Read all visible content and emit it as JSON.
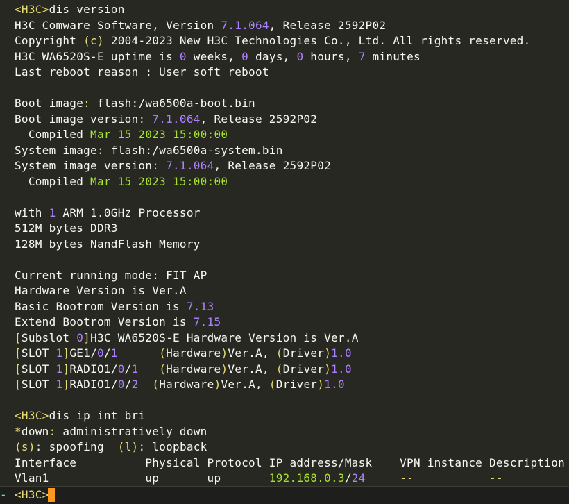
{
  "terminal": {
    "lines": [
      [
        [
          "y",
          "<H3C>"
        ],
        [
          "p",
          "dis version"
        ]
      ],
      [
        [
          "p",
          "H3C Comware Software, Version "
        ],
        [
          "n",
          "7.1.064"
        ],
        [
          "p",
          ", Release 2592P02"
        ]
      ],
      [
        [
          "p",
          "Copyright "
        ],
        [
          "y",
          "(c)"
        ],
        [
          "p",
          " 2004-2023 New H3C Technologies Co., Ltd. All rights reserved."
        ]
      ],
      [
        [
          "p",
          "H3C WA6520S-E uptime is "
        ],
        [
          "n",
          "0"
        ],
        [
          "p",
          " weeks, "
        ],
        [
          "n",
          "0"
        ],
        [
          "p",
          " days, "
        ],
        [
          "n",
          "0"
        ],
        [
          "p",
          " hours, "
        ],
        [
          "n",
          "7"
        ],
        [
          "p",
          " minutes"
        ]
      ],
      [
        [
          "p",
          "Last reboot reason : User soft reboot"
        ]
      ],
      [],
      [
        [
          "p",
          "Boot image"
        ],
        [
          "y",
          ":"
        ],
        [
          "p",
          " flash:/wa6500a-boot.bin"
        ]
      ],
      [
        [
          "p",
          "Boot image version"
        ],
        [
          "y",
          ":"
        ],
        [
          "p",
          " "
        ],
        [
          "n",
          "7.1.064"
        ],
        [
          "p",
          ", Release 2592P02"
        ]
      ],
      [
        [
          "p",
          "  Compiled "
        ],
        [
          "g",
          "Mar 15 2023 15:00:00"
        ]
      ],
      [
        [
          "p",
          "System image"
        ],
        [
          "y",
          ":"
        ],
        [
          "p",
          " flash:/wa6500a-system.bin"
        ]
      ],
      [
        [
          "p",
          "System image version"
        ],
        [
          "y",
          ":"
        ],
        [
          "p",
          " "
        ],
        [
          "n",
          "7.1.064"
        ],
        [
          "p",
          ", Release 2592P02"
        ]
      ],
      [
        [
          "p",
          "  Compiled "
        ],
        [
          "g",
          "Mar 15 2023 15:00:00"
        ]
      ],
      [],
      [
        [
          "p",
          "with "
        ],
        [
          "n",
          "1"
        ],
        [
          "p",
          " ARM 1.0GHz Processor"
        ]
      ],
      [
        [
          "p",
          "512M bytes DDR3"
        ]
      ],
      [
        [
          "p",
          "128M bytes NandFlash Memory"
        ]
      ],
      [],
      [
        [
          "p",
          "Current running mode: FIT AP"
        ]
      ],
      [
        [
          "p",
          "Hardware Version is Ver.A"
        ]
      ],
      [
        [
          "p",
          "Basic Bootrom Version is "
        ],
        [
          "n",
          "7.13"
        ]
      ],
      [
        [
          "p",
          "Extend Bootrom Version is "
        ],
        [
          "n",
          "7.15"
        ]
      ],
      [
        [
          "y",
          "["
        ],
        [
          "p",
          "Subslot "
        ],
        [
          "n",
          "0"
        ],
        [
          "y",
          "]"
        ],
        [
          "p",
          "H3C WA6520S-E Hardware Version is Ver.A"
        ]
      ],
      [
        [
          "y",
          "["
        ],
        [
          "p",
          "SLOT "
        ],
        [
          "n",
          "1"
        ],
        [
          "y",
          "]"
        ],
        [
          "p",
          "GE1/"
        ],
        [
          "n",
          "0"
        ],
        [
          "p",
          "/"
        ],
        [
          "n",
          "1"
        ],
        [
          "p",
          "      "
        ],
        [
          "y",
          "("
        ],
        [
          "p",
          "Hardware"
        ],
        [
          "y",
          ")"
        ],
        [
          "p",
          "Ver.A, "
        ],
        [
          "y",
          "("
        ],
        [
          "p",
          "Driver"
        ],
        [
          "y",
          ")"
        ],
        [
          "n",
          "1.0"
        ]
      ],
      [
        [
          "y",
          "["
        ],
        [
          "p",
          "SLOT "
        ],
        [
          "n",
          "1"
        ],
        [
          "y",
          "]"
        ],
        [
          "p",
          "RADIO1/"
        ],
        [
          "n",
          "0"
        ],
        [
          "p",
          "/"
        ],
        [
          "n",
          "1"
        ],
        [
          "p",
          "   "
        ],
        [
          "y",
          "("
        ],
        [
          "p",
          "Hardware"
        ],
        [
          "y",
          ")"
        ],
        [
          "p",
          "Ver.A, "
        ],
        [
          "y",
          "("
        ],
        [
          "p",
          "Driver"
        ],
        [
          "y",
          ")"
        ],
        [
          "n",
          "1.0"
        ]
      ],
      [
        [
          "y",
          "["
        ],
        [
          "p",
          "SLOT "
        ],
        [
          "n",
          "1"
        ],
        [
          "y",
          "]"
        ],
        [
          "p",
          "RADIO1/"
        ],
        [
          "n",
          "0"
        ],
        [
          "p",
          "/"
        ],
        [
          "n",
          "2"
        ],
        [
          "p",
          "  "
        ],
        [
          "y",
          "("
        ],
        [
          "p",
          "Hardware"
        ],
        [
          "y",
          ")"
        ],
        [
          "p",
          "Ver.A, "
        ],
        [
          "y",
          "("
        ],
        [
          "p",
          "Driver"
        ],
        [
          "y",
          ")"
        ],
        [
          "n",
          "1.0"
        ]
      ],
      [],
      [
        [
          "y",
          "<H3C>"
        ],
        [
          "p",
          "dis ip int bri"
        ]
      ],
      [
        [
          "y",
          "*"
        ],
        [
          "p",
          "down"
        ],
        [
          "y",
          ":"
        ],
        [
          "p",
          " administratively down"
        ]
      ],
      [
        [
          "y",
          "(s)"
        ],
        [
          "p",
          ": spoofing  "
        ],
        [
          "y",
          "(l)"
        ],
        [
          "p",
          ": loopback"
        ]
      ],
      [
        [
          "p",
          "Interface          Physical Protocol IP address/Mask    VPN instance Description"
        ]
      ],
      [
        [
          "p",
          "Vlan1              up       up       "
        ],
        [
          "g",
          "192.168.0.3"
        ],
        [
          "p",
          "/"
        ],
        [
          "n",
          "24"
        ],
        [
          "p",
          "     "
        ],
        [
          "y",
          "--"
        ],
        [
          "p",
          "           "
        ],
        [
          "y",
          "--"
        ]
      ]
    ]
  },
  "prompt": {
    "marker": "-",
    "label": "<H3C>"
  },
  "colors": {
    "background": "#272822",
    "text": "#f8f8f2",
    "number": "#ae81ff",
    "string": "#a6e22e",
    "keyword": "#e6db74",
    "cursor": "#fd971f"
  }
}
